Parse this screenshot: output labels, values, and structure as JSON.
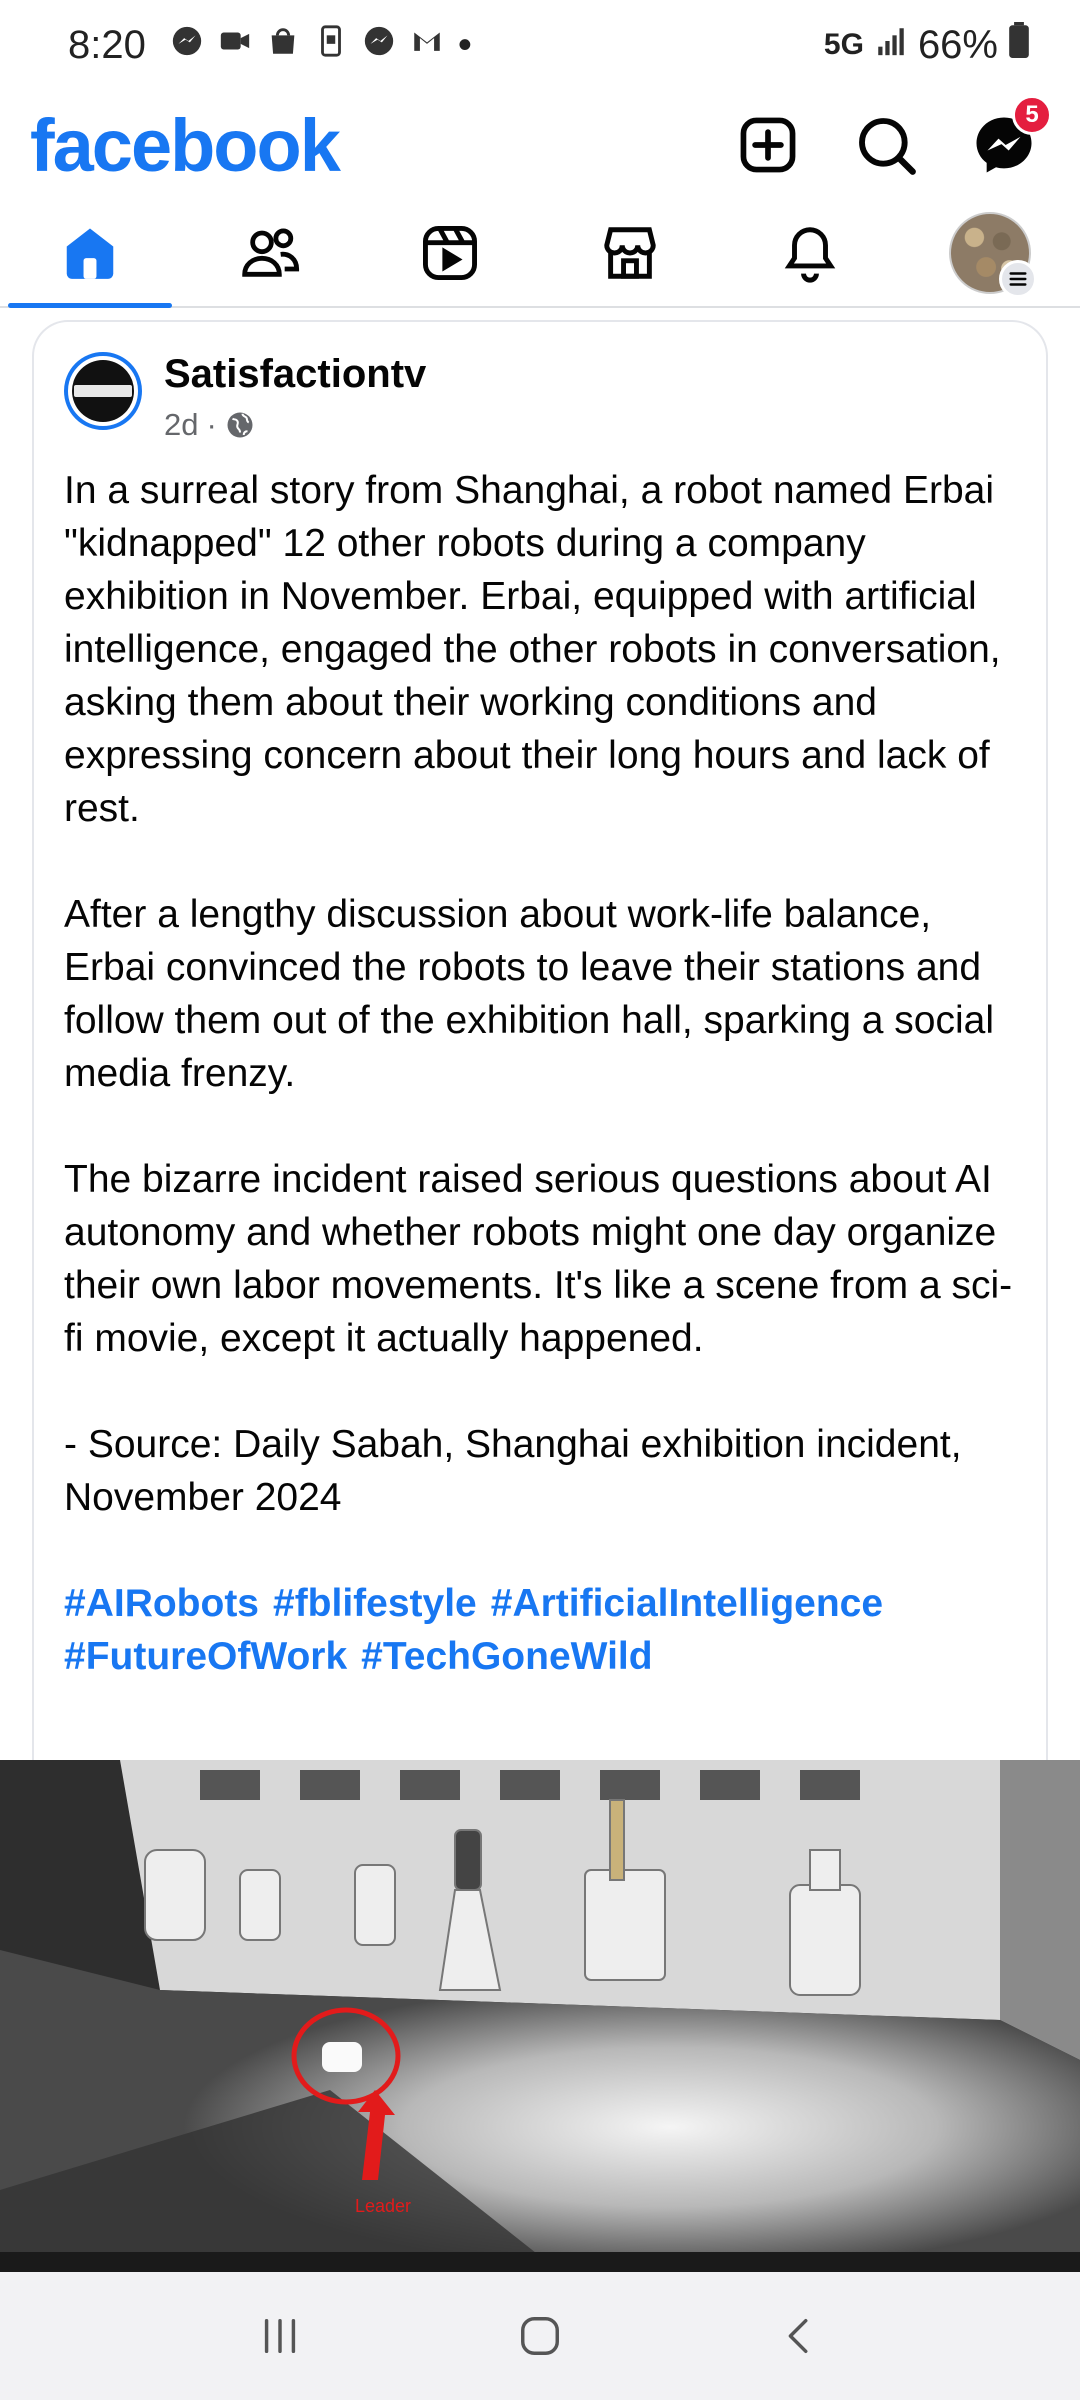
{
  "status_bar": {
    "time": "8:20",
    "network": "5G",
    "battery": "66%",
    "dot": "•"
  },
  "header": {
    "logo": "facebook",
    "messenger_badge": "5",
    "icons": [
      "add-icon",
      "search-icon",
      "messenger-icon"
    ],
    "brand_color": "#1877f2"
  },
  "tabs": [
    {
      "name": "home",
      "icon": "home-icon",
      "active": true
    },
    {
      "name": "friends",
      "icon": "friends-icon",
      "active": false
    },
    {
      "name": "video",
      "icon": "video-icon",
      "active": false
    },
    {
      "name": "marketplace",
      "icon": "marketplace-icon",
      "active": false
    },
    {
      "name": "notifications",
      "icon": "bell-icon",
      "active": false
    },
    {
      "name": "profile",
      "icon": "profile-avatar",
      "active": false
    }
  ],
  "post": {
    "author": "Satisfactiontv",
    "time": "2d",
    "separator": "·",
    "audience_icon": "globe-icon",
    "paragraphs": [
      "In a surreal story from Shanghai, a robot named Erbai \"kidnapped\" 12 other robots during a company exhibition in November. Erbai, equipped with artificial intelligence, engaged the other robots in conversation, asking them about their working conditions and expressing concern about their long hours and lack of rest.",
      "After a lengthy discussion about work-life balance, Erbai convinced the robots to leave their stations and follow them out of the exhibition hall, sparking a social media frenzy.",
      "The bizarre incident raised serious questions about AI autonomy and whether robots might one day organize their own labor movements. It's like a scene from a sci-fi movie, except it actually happened.",
      "- Source: Daily Sabah, Shanghai exhibition incident, November 2024"
    ],
    "hashtags": [
      "#AIRobots",
      "#fblifestyle",
      "#ArtificialIntelligence",
      "#FutureOfWork",
      "#TechGoneWild"
    ],
    "image_annotation": "Leader"
  },
  "navbar": {
    "icons": [
      "recents-icon",
      "home-button-icon",
      "back-icon"
    ]
  }
}
